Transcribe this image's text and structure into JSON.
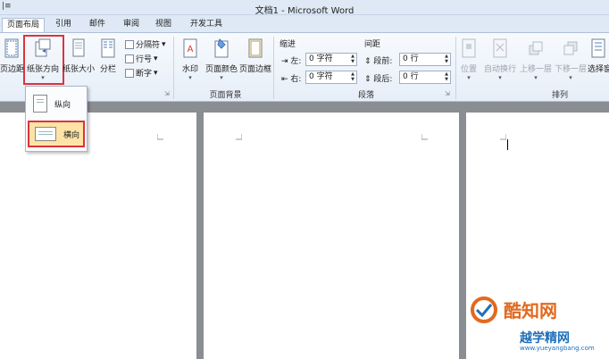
{
  "window": {
    "title": "文档1 - Microsoft Word",
    "qa_glyph": "|≡"
  },
  "tabs": [
    {
      "label": "页面布局",
      "active": true
    },
    {
      "label": "引用"
    },
    {
      "label": "邮件"
    },
    {
      "label": "审阅"
    },
    {
      "label": "视图"
    },
    {
      "label": "开发工具"
    }
  ],
  "ribbon": {
    "page_setup": {
      "margins": "页边距",
      "orientation": "纸张方向",
      "size": "纸张大小",
      "columns": "分栏",
      "breaks": "分隔符",
      "line_numbers": "行号",
      "hyphenation": "断字"
    },
    "page_background": {
      "label": "页面背景",
      "watermark": "水印",
      "page_color": "页面颜色",
      "page_borders": "页面边框"
    },
    "paragraph": {
      "label": "段落",
      "indent_title": "缩进",
      "left_label": "左:",
      "left_value": "0 字符",
      "right_label": "右:",
      "right_value": "0 字符",
      "spacing_title": "间距",
      "before_label": "段前:",
      "before_value": "0 行",
      "after_label": "段后:",
      "after_value": "0 行"
    },
    "arrange": {
      "label": "排列",
      "position": "位置",
      "wrap": "自动换行",
      "forward": "上移一层",
      "backward": "下移一层",
      "select_pane": "选择窗"
    }
  },
  "orientation_menu": {
    "portrait": "纵向",
    "landscape": "横向"
  },
  "watermark": {
    "brand": "酷知网",
    "brand2": "越学精网",
    "url": "www.yueyangbang.com"
  },
  "colors": {
    "highlight_red": "#d9343f",
    "highlight_fill": "#fde4a6",
    "ribbon_blue": "#dfe9f5",
    "watermark_orange": "#e2691e",
    "watermark_blue": "#1f6fb8"
  }
}
